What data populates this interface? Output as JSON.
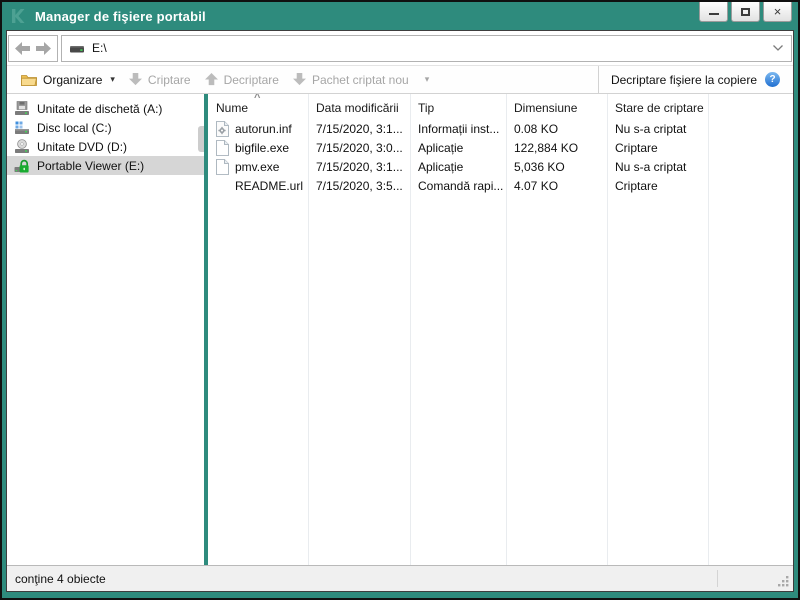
{
  "window": {
    "title": "Manager de fişiere portabil"
  },
  "navigation": {
    "address": "E:\\"
  },
  "toolbar": {
    "items": [
      {
        "label": "Organizare",
        "enabled": true,
        "dropdown": true
      },
      {
        "label": "Criptare",
        "enabled": false,
        "dropdown": false
      },
      {
        "label": "Decriptare",
        "enabled": false,
        "dropdown": false
      },
      {
        "label": "Pachet criptat nou",
        "enabled": false,
        "dropdown": true
      }
    ],
    "copy_decrypt_label": "Decriptare fişiere la copiere"
  },
  "sidebar": {
    "items": [
      {
        "label": "Unitate de dischetă (A:)",
        "icon": "floppy-drive-icon",
        "selected": false
      },
      {
        "label": "Disc local (C:)",
        "icon": "local-disk-icon",
        "selected": false
      },
      {
        "label": "Unitate DVD (D:)",
        "icon": "dvd-drive-icon",
        "selected": false
      },
      {
        "label": "Portable Viewer (E:)",
        "icon": "encrypted-drive-icon",
        "selected": true
      }
    ]
  },
  "table": {
    "columns": [
      "Nume",
      "Data modificării",
      "Tip",
      "Dimensiune",
      "Stare de criptare"
    ],
    "sort": {
      "column": "Nume",
      "direction": "ascending"
    },
    "rows": [
      {
        "icon": "setup-info-file-icon",
        "name": "autorun.inf",
        "modified": "7/15/2020, 3:1...",
        "type": "Informații inst...",
        "size": "0.08 KO",
        "encryption": "Nu s-a criptat"
      },
      {
        "icon": "file-icon",
        "name": "bigfile.exe",
        "modified": "7/15/2020, 3:0...",
        "type": "Aplicație",
        "size": "122,884 KO",
        "encryption": "Criptare"
      },
      {
        "icon": "file-icon",
        "name": "pmv.exe",
        "modified": "7/15/2020, 3:1...",
        "type": "Aplicație",
        "size": "5,036 KO",
        "encryption": "Nu s-a criptat"
      },
      {
        "icon": "none",
        "name": "README.url",
        "modified": "7/15/2020, 3:5...",
        "type": "Comandă rapi...",
        "size": "4.07 KO",
        "encryption": "Criptare"
      }
    ]
  },
  "status": {
    "text": "conţine 4 obiecte"
  },
  "icons": {
    "dropdown_caret": "▾",
    "sort_ascending": "^",
    "help_glyph": "?",
    "close_glyph": "×"
  },
  "colors": {
    "brand_teal": "#2e8b7d",
    "selection_gray": "#d6d6d6",
    "disabled_text": "#a6a6a6",
    "help_blue": "#2f7fd6",
    "led_green": "#43d457",
    "lock_green": "#19ab30"
  }
}
